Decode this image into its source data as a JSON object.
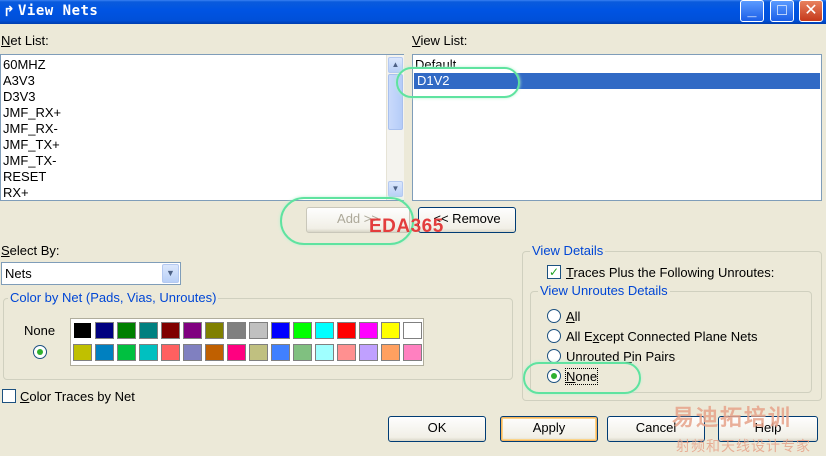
{
  "window": {
    "icon_glyph": "↱",
    "title": "View Nets",
    "controls": {
      "minimize_glyph": "_",
      "maximize_glyph": "□",
      "close_glyph": "✕"
    }
  },
  "net_list": {
    "label_mnemonic": "N",
    "label_rest": "et List:",
    "items": [
      "60MHZ",
      "A3V3",
      "D3V3",
      "JMF_RX+",
      "JMF_RX-",
      "JMF_TX+",
      "JMF_TX-",
      "RESET",
      "RX+"
    ],
    "scroll_up_glyph": "▲",
    "scroll_down_glyph": "▼"
  },
  "view_list": {
    "label_mnemonic": "V",
    "label_rest": "iew List:",
    "items": [
      {
        "text": "Default",
        "selected": false
      },
      {
        "text": "D1V2",
        "selected": true
      }
    ]
  },
  "transfer": {
    "add_label": "Add >>",
    "add_enabled": false,
    "remove_label": "<< Remove"
  },
  "select_by": {
    "label_mnemonic": "S",
    "label_rest": "elect By:",
    "value": "Nets",
    "dropdown_glyph": "▼"
  },
  "color_by_net": {
    "title": "Color by Net (Pads, Vias, Unroutes)",
    "none_label": "None",
    "none_selected": true,
    "palette_row1": [
      "#000000",
      "#000080",
      "#008000",
      "#008080",
      "#800000",
      "#800080",
      "#808000",
      "#808080",
      "#c0c0c0",
      "#0000ff",
      "#00ff00",
      "#00ffff",
      "#ff0000",
      "#ff00ff",
      "#ffff00",
      "#ffffff"
    ],
    "palette_row2": [
      "#c0c000",
      "#0080c0",
      "#00c040",
      "#00c0c0",
      "#ff6060",
      "#8080c0",
      "#c06000",
      "#ff0080",
      "#c0c080",
      "#4080ff",
      "#80c080",
      "#a0ffff",
      "#ff9090",
      "#c0a0ff",
      "#ffa060",
      "#ff80c0"
    ]
  },
  "color_traces_by_net": {
    "label_mnemonic": "C",
    "label_rest": "olor Traces by Net",
    "checked": false
  },
  "view_details": {
    "title": "View Details",
    "traces_plus": {
      "label_mnemonic": "T",
      "label_rest": "races Plus the Following Unroutes:",
      "checked": true,
      "check_glyph": "✓"
    },
    "unroutes_details": {
      "title": "View Unroutes Details",
      "options": [
        {
          "pre": "",
          "mnemonic": "A",
          "post": "ll",
          "selected": false
        },
        {
          "pre": "All E",
          "mnemonic": "x",
          "post": "cept Connected Plane Nets",
          "selected": false
        },
        {
          "pre": "Unrouted ",
          "mnemonic": "P",
          "post": "in Pairs",
          "selected": false
        },
        {
          "pre": "",
          "mnemonic": "N",
          "post": "one",
          "selected": true
        }
      ]
    }
  },
  "buttons": {
    "ok": "OK",
    "apply": "Apply",
    "cancel": "Cancel",
    "help": "Help"
  },
  "watermarks": {
    "eda": "EDA365",
    "cn_main": "易迪拓培训",
    "cn_sub": "射频和天线设计专家"
  }
}
